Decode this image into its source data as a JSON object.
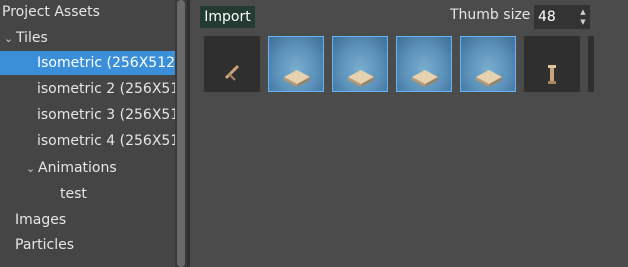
{
  "panel": {
    "title": "Project Assets",
    "tree": [
      {
        "label": "Tiles",
        "expanded": true
      },
      {
        "label": "Isometric (256X512",
        "selected": true
      },
      {
        "label": "isometric 2 (256X51"
      },
      {
        "label": "isometric 3 (256X51"
      },
      {
        "label": "isometric 4 (256X51"
      },
      {
        "label": "Animations",
        "expanded": true
      },
      {
        "label": "test"
      },
      {
        "label": "Images"
      },
      {
        "label": "Particles"
      }
    ]
  },
  "toolbar": {
    "import_label": "Import",
    "thumb_size_label": "Thumb size",
    "thumb_size_value": "48"
  },
  "colors": {
    "selection": "#3a8fd8",
    "import_bg": "#243b32",
    "tile_selected_border": "#64b4ff"
  },
  "icons": {
    "spin_up": "▲",
    "spin_down": "▼",
    "caret": "⌄"
  }
}
